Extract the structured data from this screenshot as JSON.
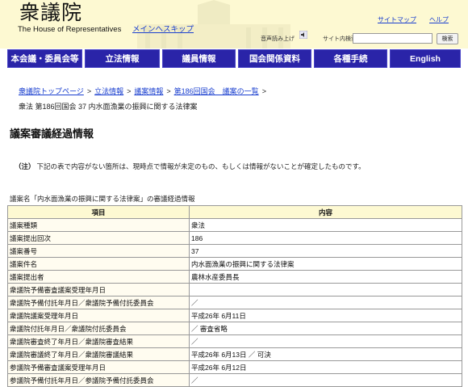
{
  "header": {
    "logo_text": "衆議院",
    "logo_subtitle": "The House of Representatives",
    "skip_link": "メインへスキップ",
    "sitemap": "サイトマップ",
    "help": "ヘルプ",
    "audio_label": "音声読み上げ",
    "search_label": "サイト内検索",
    "search_value": "",
    "search_button": "検索"
  },
  "gnav": {
    "items": [
      "本会議・委員会等",
      "立法情報",
      "議員情報",
      "国会関係資料",
      "各種手続",
      "English"
    ]
  },
  "breadcrumb": {
    "items": [
      "衆議院トップページ",
      "立法情報",
      "議案情報",
      "第186回国会　議案の一覧"
    ],
    "separator": ">",
    "current": "衆法 第186回国会 37 内水面漁業の振興に関する法律案"
  },
  "page_title": "議案審議経過情報",
  "note": {
    "label": "（注）",
    "text": "下記の表で内容がない箇所は、現時点で情報が未定のもの、もしくは情報がないことが確定したものです。"
  },
  "table": {
    "caption": "議案名「内水面漁業の振興に関する法律案」の審議経過情報",
    "headers": [
      "項目",
      "内容"
    ],
    "rows": [
      [
        "議案種類",
        "衆法"
      ],
      [
        "議案提出回次",
        "186"
      ],
      [
        "議案番号",
        "37"
      ],
      [
        "議案件名",
        "内水面漁業の振興に関する法律案"
      ],
      [
        "議案提出者",
        "農林水産委員長"
      ],
      [
        "衆議院予備審査議案受理年月日",
        ""
      ],
      [
        "衆議院予備付託年月日／衆議院予備付託委員会",
        "／"
      ],
      [
        "衆議院議案受理年月日",
        "平成26年 6月11日"
      ],
      [
        "衆議院付託年月日／衆議院付託委員会",
        "／ 審査省略"
      ],
      [
        "衆議院審査終了年月日／衆議院審査結果",
        "／"
      ],
      [
        "衆議院審議終了年月日／衆議院審議結果",
        "平成26年 6月13日 ／ 可決"
      ],
      [
        "参議院予備審査議案受理年月日",
        "平成26年 6月12日"
      ],
      [
        "参議院予備付託年月日／参議院予備付託委員会",
        "／"
      ]
    ]
  }
}
